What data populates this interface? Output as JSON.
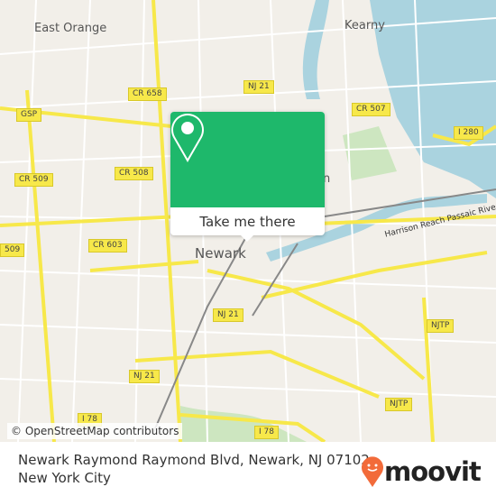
{
  "map": {
    "place_labels": [
      "East Orange",
      "Kearny",
      "Newark",
      "on"
    ],
    "road_shields": [
      "CR 658",
      "NJ 21",
      "CR 507",
      "GSP",
      "I 280",
      "CR 509",
      "CR 508",
      "509",
      "CR 603",
      "NJ 21",
      "NJTP",
      "NJ 21",
      "NJTP",
      "I 78",
      "I 78"
    ],
    "river_label": "Harrison Reach Passaic River",
    "attribution": "© OpenStreetMap contributors",
    "colors": {
      "land": "#f2efe9",
      "water": "#aad3df",
      "road": "#f7e84a",
      "park": "#cde6c0"
    }
  },
  "popup": {
    "icon": "location-pin-icon",
    "button_label": "Take me there",
    "color": "#1eb86b"
  },
  "footer": {
    "address_line1": "Newark Raymond Raymond Blvd, Newark, NJ 07102,",
    "address_line2": "New York City",
    "brand": "moovit",
    "brand_color": "#f26b3a"
  }
}
